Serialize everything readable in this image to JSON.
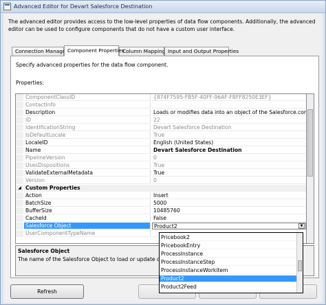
{
  "window": {
    "title": "Advanced Editor for Devart Salesforce Destination"
  },
  "description": "The advanced editor provides access to the low-level properties of data flow components. Additionally, the advanced editor can be used to configure components that do not have a custom user interface.",
  "tabs": [
    {
      "label": "Connection Managers"
    },
    {
      "label": "Component Properties"
    },
    {
      "label": "Column Mappings"
    },
    {
      "label": "Input and Output Properties"
    }
  ],
  "page": {
    "specify_text": "Specify advanced properties for the data flow component.",
    "properties_label": "Properties:"
  },
  "grid": {
    "rows": [
      {
        "name": "ComponentClassID",
        "value": "{874F7595-FB5F-40FF-96AF-FBFF8250E3EF}",
        "style": "gray"
      },
      {
        "name": "ContactInfo",
        "value": "",
        "style": "gray"
      },
      {
        "name": "Description",
        "value": "Loads or modifies data into an object of the Salesforce.com(or Dat",
        "style": "normal"
      },
      {
        "name": "ID",
        "value": "22",
        "style": "gray"
      },
      {
        "name": "IdentificationString",
        "value": "Devart Salesforce Destination",
        "style": "gray"
      },
      {
        "name": "IsDefaultLocale",
        "value": "True",
        "style": "gray"
      },
      {
        "name": "LocaleID",
        "value": "English (United States)",
        "style": "normal"
      },
      {
        "name": "Name",
        "value": "Devart Salesforce Destination",
        "style": "bold"
      },
      {
        "name": "PipelineVersion",
        "value": "0",
        "style": "gray"
      },
      {
        "name": "UsesDispositions",
        "value": "True",
        "style": "gray"
      },
      {
        "name": "ValidateExternalMetadata",
        "value": "True",
        "style": "normal"
      },
      {
        "name": "Version",
        "value": "0",
        "style": "gray"
      },
      {
        "name": "Custom Properties",
        "value": "",
        "style": "category"
      },
      {
        "name": "Action",
        "value": "Insert",
        "style": "normal"
      },
      {
        "name": "BatchSize",
        "value": "5000",
        "style": "normal"
      },
      {
        "name": "BufferSize",
        "value": "10485760",
        "style": "normal"
      },
      {
        "name": "CacheId",
        "value": "False",
        "style": "normal"
      },
      {
        "name": "Salesforce Object",
        "value": "Product2",
        "style": "selected"
      },
      {
        "name": "UserComponentTypeName",
        "value": "",
        "style": "gray"
      }
    ],
    "collapse_glyph": "◢"
  },
  "help": {
    "title": "Salesforce Object",
    "text": "The name of the Salesforce Object to load or update data."
  },
  "dropdown": {
    "items": [
      "Pricebook2",
      "PricebookEntry",
      "ProcessInstance",
      "ProcessInstanceStep",
      "ProcessInstanceWorkitem",
      "Product2",
      "Product2Feed"
    ],
    "selected_index": 5,
    "arrow_glyph": "▼"
  },
  "buttons": {
    "refresh": "Refresh"
  }
}
